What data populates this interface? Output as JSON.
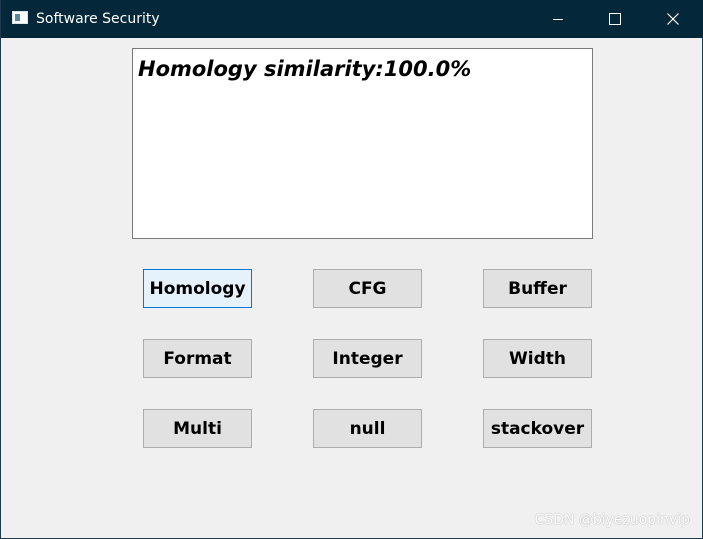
{
  "window": {
    "title": "Software Security",
    "icon": "app-window-icon",
    "controls": {
      "minimize_icon": "minimize-icon",
      "maximize_icon": "maximize-icon",
      "close_icon": "close-icon"
    },
    "titlebar_color": "#04283a"
  },
  "output": {
    "text": "Homology similarity:100.0%"
  },
  "buttons": {
    "homology": "Homology",
    "cfg": "CFG",
    "buffer": "Buffer",
    "format": "Format",
    "integer": "Integer",
    "width": "Width",
    "multi": "Multi",
    "null": "null",
    "stackover": "stackover"
  },
  "focused_button": "Homology",
  "colors": {
    "focus_border": "#0078d7",
    "button_face": "#e1e1e1"
  },
  "watermark": "CSDN @biyezuopinvip"
}
